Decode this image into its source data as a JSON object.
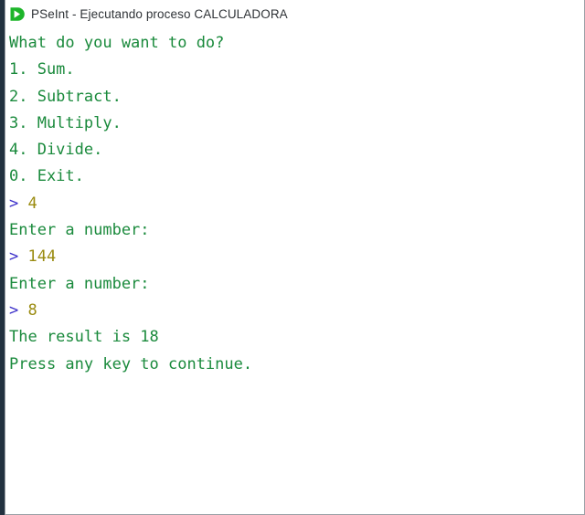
{
  "window": {
    "title": "PSeInt - Ejecutando proceso CALCULADORA",
    "icon": "play-run-icon",
    "colors": {
      "edge_strip": "#22313f",
      "border": "#9aa0a6",
      "background": "#ffffff",
      "title_text": "#2f3337",
      "console_output": "#1a8a3c",
      "prompt_symbol": "#3b2fc9",
      "typed_input": "#9a8b10",
      "icon_green": "#1db52a"
    }
  },
  "console": {
    "lines": [
      {
        "kind": "output",
        "text": "What do you want to do?"
      },
      {
        "kind": "output",
        "text": "1. Sum."
      },
      {
        "kind": "output",
        "text": "2. Subtract."
      },
      {
        "kind": "output",
        "text": "3. Multiply."
      },
      {
        "kind": "output",
        "text": "4. Divide."
      },
      {
        "kind": "output",
        "text": "0. Exit."
      },
      {
        "kind": "input",
        "prompt": "> ",
        "value": "4"
      },
      {
        "kind": "output",
        "text": "Enter a number:"
      },
      {
        "kind": "input",
        "prompt": "> ",
        "value": "144"
      },
      {
        "kind": "output",
        "text": "Enter a number:"
      },
      {
        "kind": "input",
        "prompt": "> ",
        "value": "8"
      },
      {
        "kind": "output",
        "text": "The result is 18"
      },
      {
        "kind": "output",
        "text": "Press any key to continue."
      }
    ]
  }
}
